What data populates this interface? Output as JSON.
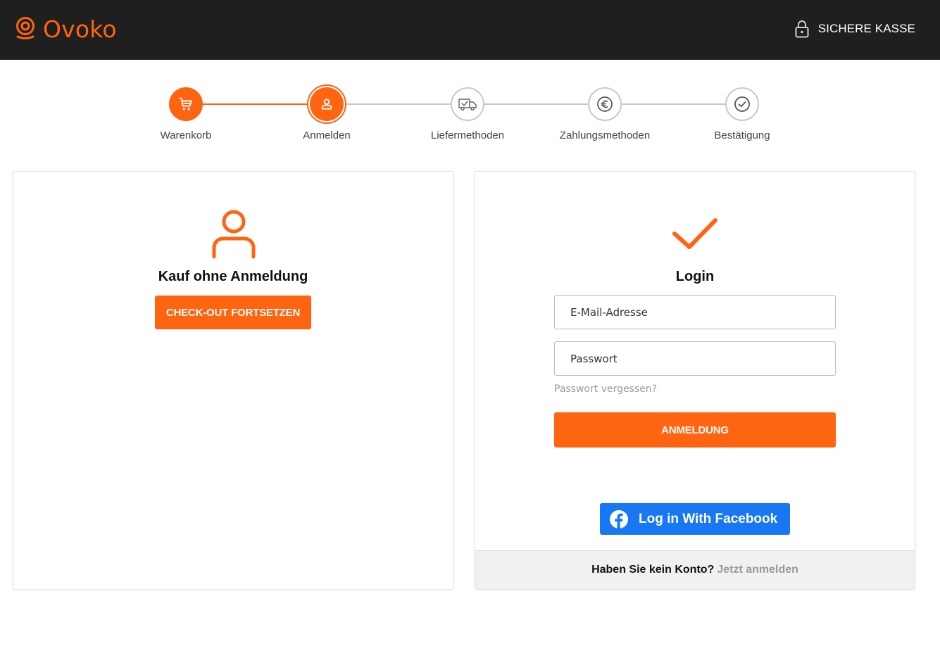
{
  "header": {
    "brand": "Ovoko",
    "secure_label": "SICHERE KASSE",
    "brand_color": "#ff6410",
    "background": "#1f1f1f"
  },
  "stepper": {
    "current_index": 1,
    "steps": [
      {
        "label": "Warenkorb",
        "icon": "cart-icon",
        "state": "done"
      },
      {
        "label": "Anmelden",
        "icon": "user-icon",
        "state": "current"
      },
      {
        "label": "Liefermethoden",
        "icon": "delivery-truck-icon",
        "state": "upcoming"
      },
      {
        "label": "Zahlungsmethoden",
        "icon": "euro-icon",
        "state": "upcoming"
      },
      {
        "label": "Bestätigung",
        "icon": "check-circle-icon",
        "state": "upcoming"
      }
    ]
  },
  "guest": {
    "icon": "user-icon",
    "title": "Kauf ohne Anmeldung",
    "button_label": "CHECK-OUT FORTSETZEN"
  },
  "login": {
    "icon": "checkmark-icon",
    "title": "Login",
    "email_placeholder": "E-Mail-Adresse",
    "password_placeholder": "Passwort",
    "forgot_label": "Passwort vergessen?",
    "submit_label": "ANMELDUNG",
    "facebook_label": "Log in With Facebook",
    "facebook_color": "#1877f2",
    "no_account_question": "Haben Sie kein Konto?",
    "register_link": "Jetzt anmelden"
  }
}
